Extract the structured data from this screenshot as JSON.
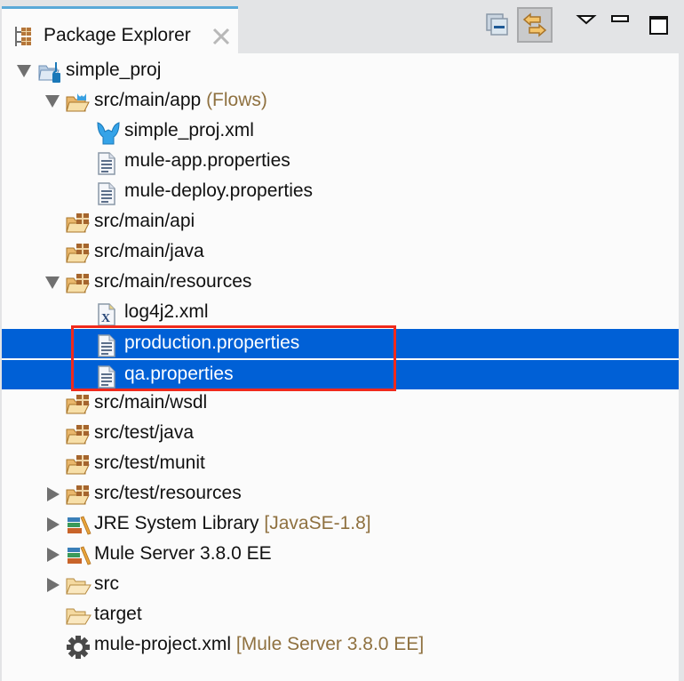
{
  "view": {
    "tab_title": "Package Explorer",
    "tab_icon": "package-explorer-icon",
    "close_icon": "close-icon",
    "accent_color": "#5aa9d8",
    "selection_color": "#0060d6",
    "highlight_box_color": "#f02a1c"
  },
  "toolbar": {
    "buttons": [
      {
        "name": "collapse-all",
        "icon": "collapse-all-icon",
        "pressed": false
      },
      {
        "name": "link-with-editor",
        "icon": "link-with-editor-icon",
        "pressed": true
      },
      {
        "name": "view-menu",
        "icon": "chevron-down-icon",
        "pressed": false
      },
      {
        "name": "minimize",
        "icon": "minimize-icon",
        "pressed": false
      },
      {
        "name": "maximize",
        "icon": "maximize-icon",
        "pressed": false
      }
    ]
  },
  "tree": {
    "items": [
      {
        "label": "simple_proj",
        "decoration": "",
        "depth": 0,
        "twisty": "expanded",
        "icon": "mule-project-icon",
        "selected": false
      },
      {
        "label": "src/main/app",
        "decoration": "(Flows)",
        "depth": 1,
        "twisty": "expanded",
        "icon": "mule-flows-folder-icon",
        "selected": false
      },
      {
        "label": "simple_proj.xml",
        "decoration": "",
        "depth": 2,
        "twisty": "none",
        "icon": "mule-flow-file-icon",
        "selected": false
      },
      {
        "label": "mule-app.properties",
        "decoration": "",
        "depth": 2,
        "twisty": "none",
        "icon": "properties-file-icon",
        "selected": false
      },
      {
        "label": "mule-deploy.properties",
        "decoration": "",
        "depth": 2,
        "twisty": "none",
        "icon": "properties-file-icon",
        "selected": false
      },
      {
        "label": "src/main/api",
        "decoration": "",
        "depth": 1,
        "twisty": "none",
        "icon": "source-folder-icon",
        "selected": false
      },
      {
        "label": "src/main/java",
        "decoration": "",
        "depth": 1,
        "twisty": "none",
        "icon": "source-folder-icon",
        "selected": false
      },
      {
        "label": "src/main/resources",
        "decoration": "",
        "depth": 1,
        "twisty": "expanded",
        "icon": "source-folder-icon",
        "selected": false
      },
      {
        "label": "log4j2.xml",
        "decoration": "",
        "depth": 2,
        "twisty": "none",
        "icon": "xml-file-icon",
        "selected": false
      },
      {
        "label": "production.properties",
        "decoration": "",
        "depth": 2,
        "twisty": "none",
        "icon": "properties-file-icon",
        "selected": true
      },
      {
        "label": "qa.properties",
        "decoration": "",
        "depth": 2,
        "twisty": "none",
        "icon": "properties-file-icon",
        "selected": true
      },
      {
        "label": "src/main/wsdl",
        "decoration": "",
        "depth": 1,
        "twisty": "none",
        "icon": "source-folder-icon",
        "selected": false
      },
      {
        "label": "src/test/java",
        "decoration": "",
        "depth": 1,
        "twisty": "none",
        "icon": "source-folder-icon",
        "selected": false
      },
      {
        "label": "src/test/munit",
        "decoration": "",
        "depth": 1,
        "twisty": "none",
        "icon": "source-folder-icon",
        "selected": false
      },
      {
        "label": "src/test/resources",
        "decoration": "",
        "depth": 1,
        "twisty": "collapsed",
        "icon": "source-folder-icon",
        "selected": false
      },
      {
        "label": "JRE System Library",
        "decoration": "[JavaSE-1.8]",
        "depth": 1,
        "twisty": "collapsed",
        "icon": "library-icon",
        "selected": false
      },
      {
        "label": "Mule Server 3.8.0 EE",
        "decoration": "",
        "depth": 1,
        "twisty": "collapsed",
        "icon": "library-icon",
        "selected": false
      },
      {
        "label": "src",
        "decoration": "",
        "depth": 1,
        "twisty": "collapsed",
        "icon": "folder-icon",
        "selected": false
      },
      {
        "label": "target",
        "decoration": "",
        "depth": 1,
        "twisty": "none",
        "icon": "folder-icon",
        "selected": false
      },
      {
        "label": "mule-project.xml",
        "decoration": "[Mule Server 3.8.0 EE]",
        "depth": 1,
        "twisty": "none",
        "icon": "gear-icon",
        "selected": false
      }
    ]
  }
}
